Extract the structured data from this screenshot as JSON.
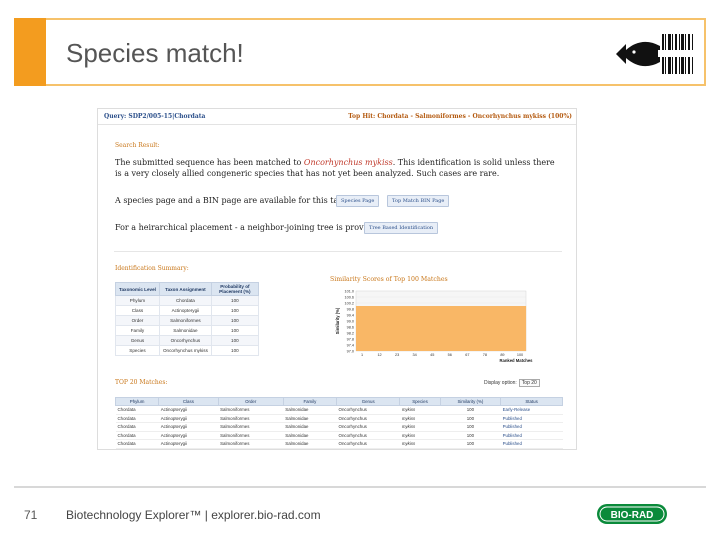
{
  "slide": {
    "title": "Species match!",
    "page_number": "71",
    "footer": "Biotechnology Explorer™ | explorer.bio-rad.com",
    "brand_logo_text": "BIO-RAD",
    "accent_color": "#f39c1f"
  },
  "screenshot": {
    "query_label": "Query: SDP2/005-15|Chordata",
    "top_hit_label": "Top Hit: Chordata - Salmoniformes - Oncorhynchus mykiss (100%)",
    "search_result_heading": "Search Result:",
    "result_text_pre": "The submitted sequence has been matched to ",
    "result_species": "Oncorhynchus mykiss",
    "result_text_post": ". This identification is solid unless there is a very closely allied congeneric species that has not yet been analyzed. Such cases are rare.",
    "pages_text": "A species page and a BIN page are available for this taxon:",
    "species_page_button": "Species Page",
    "bin_page_button": "Top Match BIN Page",
    "tree_text": "For a heirarchical placement - a neighbor-joining tree is provided:",
    "tree_button": "Tree Based Identification",
    "id_summary_heading": "Identification Summary:",
    "id_summary": {
      "headers": [
        "Taxonomic Level",
        "Taxon Assignment",
        "Probability of Placement (%)"
      ],
      "rows": [
        [
          "Phylum",
          "Chordata",
          "100"
        ],
        [
          "Class",
          "Actinopterygii",
          "100"
        ],
        [
          "Order",
          "Salmoniformes",
          "100"
        ],
        [
          "Family",
          "Salmonidae",
          "100"
        ],
        [
          "Genus",
          "Oncorhynchus",
          "100"
        ],
        [
          "Species",
          "Oncorhynchus mykiss",
          "100"
        ]
      ]
    },
    "top20_heading": "TOP 20 Matches:",
    "display_option_label": "Display option:",
    "display_option_value": "Top 20",
    "top20": {
      "headers": [
        "Phylum",
        "Class",
        "Order",
        "Family",
        "Genus",
        "Species",
        "Similarity (%)",
        "Status"
      ],
      "rows": [
        [
          "Chordata",
          "Actinopterygii",
          "Salmoniformes",
          "Salmonidae",
          "Oncorhynchus",
          "mykiss",
          "100",
          "Early-Release"
        ],
        [
          "Chordata",
          "Actinopterygii",
          "Salmoniformes",
          "Salmonidae",
          "Oncorhynchus",
          "mykiss",
          "100",
          "Published"
        ],
        [
          "Chordata",
          "Actinopterygii",
          "Salmoniformes",
          "Salmonidae",
          "Oncorhynchus",
          "mykiss",
          "100",
          "Published"
        ],
        [
          "Chordata",
          "Actinopterygii",
          "Salmoniformes",
          "Salmonidae",
          "Oncorhynchus",
          "mykiss",
          "100",
          "Published"
        ],
        [
          "Chordata",
          "Actinopterygii",
          "Salmoniformes",
          "Salmonidae",
          "Oncorhynchus",
          "mykiss",
          "100",
          "Published"
        ]
      ]
    }
  },
  "chart_data": {
    "type": "bar",
    "title": "Similarity Scores of Top 100 Matches",
    "xlabel": "Ranked Matches",
    "ylabel": "Similarity (%)",
    "y_ticks": [
      "101.0",
      "100.6",
      "100.2",
      "99.8",
      "99.4",
      "99.0",
      "98.6",
      "98.2",
      "97.8",
      "97.4",
      "97.0"
    ],
    "x_ticks": [
      "1",
      "12",
      "23",
      "34",
      "45",
      "56",
      "67",
      "78",
      "89",
      "100"
    ],
    "ylim": [
      97.0,
      101.0
    ],
    "xlim": [
      1,
      100
    ],
    "bar_color": "#f9b766",
    "values": [
      100,
      100,
      100,
      100,
      100,
      100,
      100,
      100,
      100,
      100
    ]
  }
}
